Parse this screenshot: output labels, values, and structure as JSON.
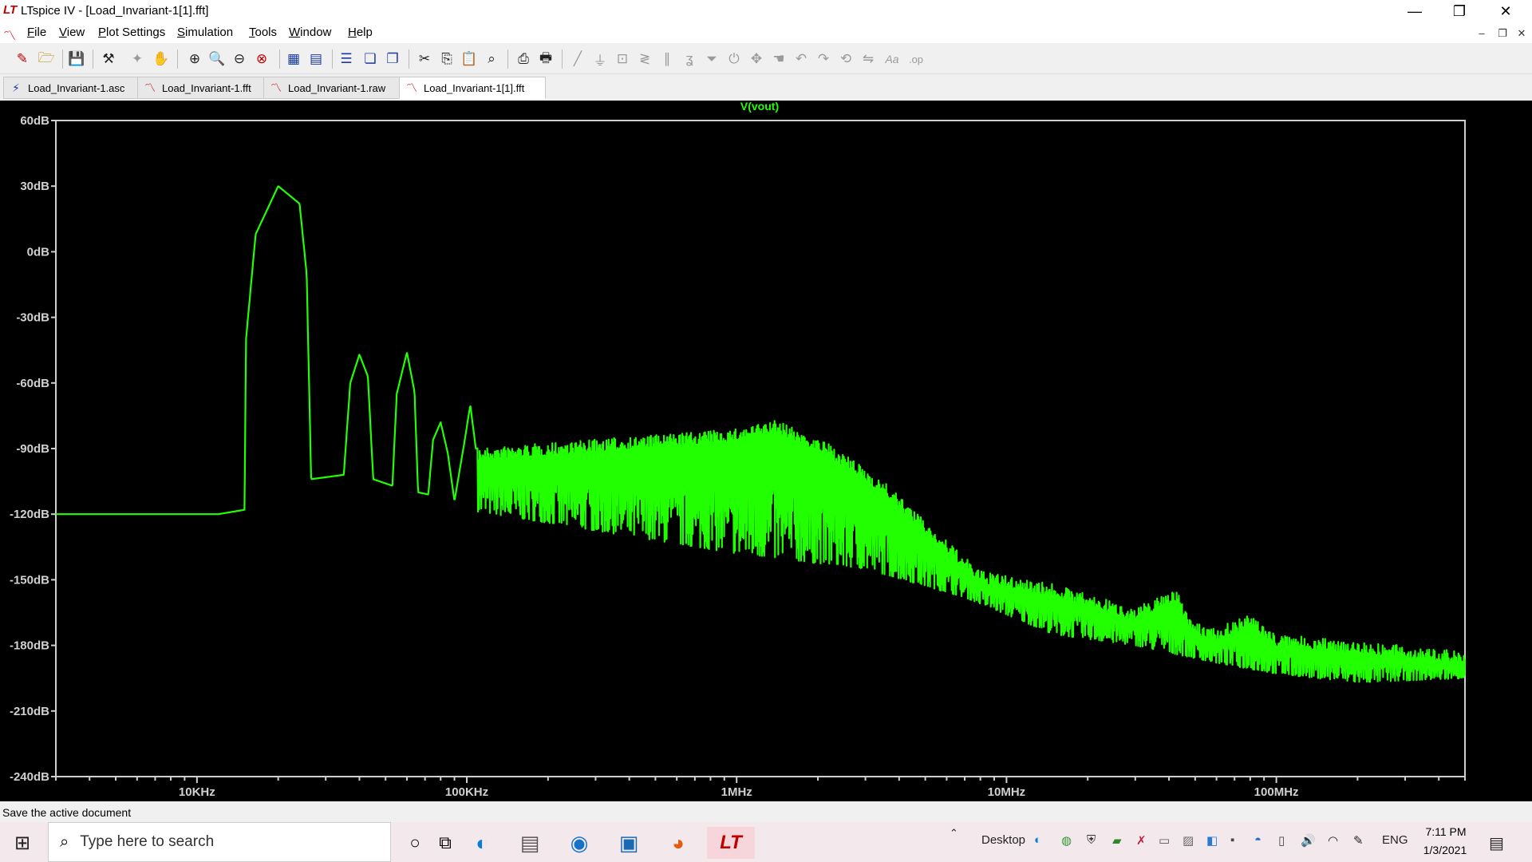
{
  "window": {
    "title": "LTspice IV - [Load_Invariant-1[1].fft]",
    "logo": "LT",
    "controls": [
      "—",
      "❐",
      "✕"
    ]
  },
  "menu": [
    {
      "key": "F",
      "rest": "ile"
    },
    {
      "key": "V",
      "rest": "iew"
    },
    {
      "key": "P",
      "rest": "lot Settings"
    },
    {
      "key": "S",
      "rest": "imulation"
    },
    {
      "key": "T",
      "rest": "ools"
    },
    {
      "key": "W",
      "rest": "indow"
    },
    {
      "key": "H",
      "rest": "elp"
    }
  ],
  "tabs": [
    {
      "label": "Load_Invariant-1.asc",
      "icon": "schematic-icon"
    },
    {
      "label": "Load_Invariant-1.fft",
      "icon": "waveform-icon"
    },
    {
      "label": "Load_Invariant-1.raw",
      "icon": "waveform-icon"
    },
    {
      "label": "Load_Invariant-1[1].fft",
      "icon": "waveform-icon",
      "active": true
    }
  ],
  "chart_data": {
    "type": "line",
    "title": "V(vout)",
    "xlabel": "",
    "ylabel": "",
    "x_scale": "log",
    "xlim": [
      3000,
      500000000
    ],
    "ylim": [
      -240,
      60
    ],
    "y_ticks": [
      "60dB",
      "30dB",
      "0dB",
      "-30dB",
      "-60dB",
      "-90dB",
      "-120dB",
      "-150dB",
      "-180dB",
      "-210dB",
      "-240dB"
    ],
    "x_ticks": [
      "10KHz",
      "100KHz",
      "1MHz",
      "10MHz",
      "100MHz"
    ],
    "line_color": "#22ff00",
    "series": [
      {
        "envelope_top": [
          [
            3000,
            -120
          ],
          [
            12000,
            -120
          ],
          [
            15000,
            -118
          ],
          [
            15200,
            -40
          ],
          [
            16500,
            8
          ],
          [
            20000,
            30
          ],
          [
            24000,
            22
          ],
          [
            25500,
            -10
          ],
          [
            26500,
            -104
          ],
          [
            35000,
            -102
          ],
          [
            37000,
            -60
          ],
          [
            40000,
            -47
          ],
          [
            43000,
            -57
          ],
          [
            45000,
            -104
          ],
          [
            53000,
            -107
          ],
          [
            55000,
            -65
          ],
          [
            60000,
            -46
          ],
          [
            64000,
            -64
          ],
          [
            66000,
            -110
          ],
          [
            72000,
            -111
          ],
          [
            75000,
            -86
          ],
          [
            80000,
            -78
          ],
          [
            85000,
            -92
          ],
          [
            90000,
            -114
          ],
          [
            98000,
            -87
          ],
          [
            103000,
            -70
          ],
          [
            108000,
            -90
          ],
          [
            1000000.0,
            -81
          ],
          [
            1400000.0,
            -77
          ],
          [
            2200000.0,
            -88
          ],
          [
            3500000.0,
            -105
          ],
          [
            5500000.0,
            -128
          ],
          [
            8000000.0,
            -146
          ],
          [
            15000000.0,
            -152
          ],
          [
            30000000.0,
            -163
          ],
          [
            42000000.0,
            -154
          ],
          [
            50000000.0,
            -170
          ],
          [
            60000000.0,
            -172
          ],
          [
            80000000.0,
            -166
          ],
          [
            100000000.0,
            -175
          ],
          [
            200000000.0,
            -178
          ],
          [
            500000000.0,
            -183
          ]
        ],
        "envelope_bottom": [
          [
            3000,
            -120
          ],
          [
            15000,
            -118
          ],
          [
            100000,
            -118
          ],
          [
            200000,
            -124
          ],
          [
            500000,
            -132
          ],
          [
            1000000.0,
            -138
          ],
          [
            3000000.0,
            -145
          ],
          [
            7000000.0,
            -158
          ],
          [
            15000000.0,
            -175
          ],
          [
            30000000.0,
            -180
          ],
          [
            60000000.0,
            -188
          ],
          [
            100000000.0,
            -193
          ],
          [
            200000000.0,
            -197
          ],
          [
            500000000.0,
            -195
          ]
        ]
      }
    ],
    "grid": false
  },
  "status": "Save the active document",
  "taskbar": {
    "search_placeholder": "Type here to search",
    "desktop_label": "Desktop",
    "language": "ENG",
    "time": "7:11 PM",
    "date": "1/3/2021"
  }
}
